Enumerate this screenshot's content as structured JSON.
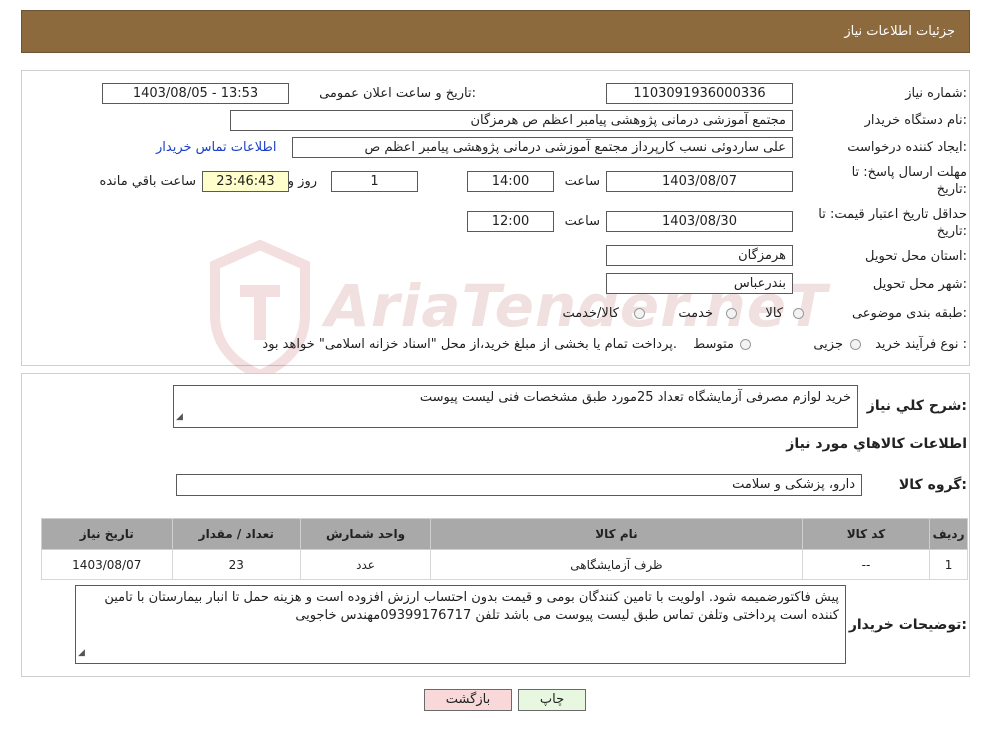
{
  "header": {
    "title": "جزئیات اطلاعات نیاز"
  },
  "form": {
    "need_number_label": "شماره نیاز:",
    "need_number": "1103091936000336",
    "announce_label": "تاریخ و ساعت اعلان عمومی:",
    "announce_value": "1403/08/05 - 13:53",
    "buyer_org_label": "نام دستگاه خریدار:",
    "buyer_org": "مجتمع آموزشی درمانی پژوهشی پیامبر اعظم ص  هرمزگان",
    "requester_label": "ایجاد کننده درخواست:",
    "requester": "علی ساردوئی نسب کارپرداز مجتمع آموزشی درمانی پژوهشی پیامبر اعظم ص",
    "contact_link": "اطلاعات تماس خریدار",
    "deadline_label_1": "مهلت ارسال پاسخ: تا",
    "deadline_label_2": "تاریخ:",
    "deadline_date": "1403/08/07",
    "time_label": "ساعت",
    "deadline_time": "14:00",
    "days_value": "1",
    "days_label": "روز و",
    "remaining_time": "23:46:43",
    "remaining_label": "ساعت باقي مانده",
    "validity_label_1": "حداقل تاریخ اعتبار قیمت: تا",
    "validity_label_2": "تاریخ:",
    "validity_date": "1403/08/30",
    "validity_time_label": "ساعت",
    "validity_time": "12:00",
    "province_label": "استان محل تحویل:",
    "province": "هرمزگان",
    "city_label": "شهر محل تحویل:",
    "city": "بندرعباس",
    "category_label": "طبقه بندی موضوعی:",
    "category_options": [
      "کالا",
      "خدمت",
      "کالا/خدمت"
    ],
    "process_label": "نوع فرآیند خرید :",
    "process_options": [
      "جزیی",
      "متوسط"
    ],
    "process_note": "پرداخت تمام یا بخشی از مبلغ خرید،از محل \"اسناد خزانه اسلامی\" خواهد بود."
  },
  "details": {
    "summary_label": "شرح کلي نياز:",
    "summary": "خرید لوازم مصرفی آزمایشگاه تعداد 25مورد طبق مشخصات فنی لیست پیوست",
    "goods_info_title": "اطلاعات کالاهاي مورد نياز",
    "group_label": "گروه کالا:",
    "group_value": "دارو، پزشکی و سلامت",
    "table": {
      "headers": [
        "رديف",
        "کد کالا",
        "نام کالا",
        "واحد شمارش",
        "تعداد / مقدار",
        "تاریخ نیاز"
      ],
      "rows": [
        [
          "1",
          "--",
          "ظرف آزمایشگاهی",
          "عدد",
          "23",
          "1403/08/07"
        ]
      ]
    },
    "buyer_notes_label": "توضیحات خریدار:",
    "buyer_notes": "پیش فاکتورضمیمه شود. اولویت با تامین کنندگان بومی و قیمت بدون احتساب ارزش افزوده است و هزینه حمل تا انبار بیمارستان با تامین کننده است پرداختی وتلفن تماس طبق لیست پیوست می باشد تلفن 09399176717مهندس خاجویی"
  },
  "buttons": {
    "print": "چاپ",
    "back": "بازگشت"
  },
  "watermark": {
    "text": "AriaTender.neT"
  },
  "colors": {
    "header_bg": "#8c6a3e",
    "table_header_bg": "#a9a9a9",
    "highlight_box": "#ffffcc",
    "back_button": "#f8d8d8",
    "print_button": "#e8f8e0"
  }
}
